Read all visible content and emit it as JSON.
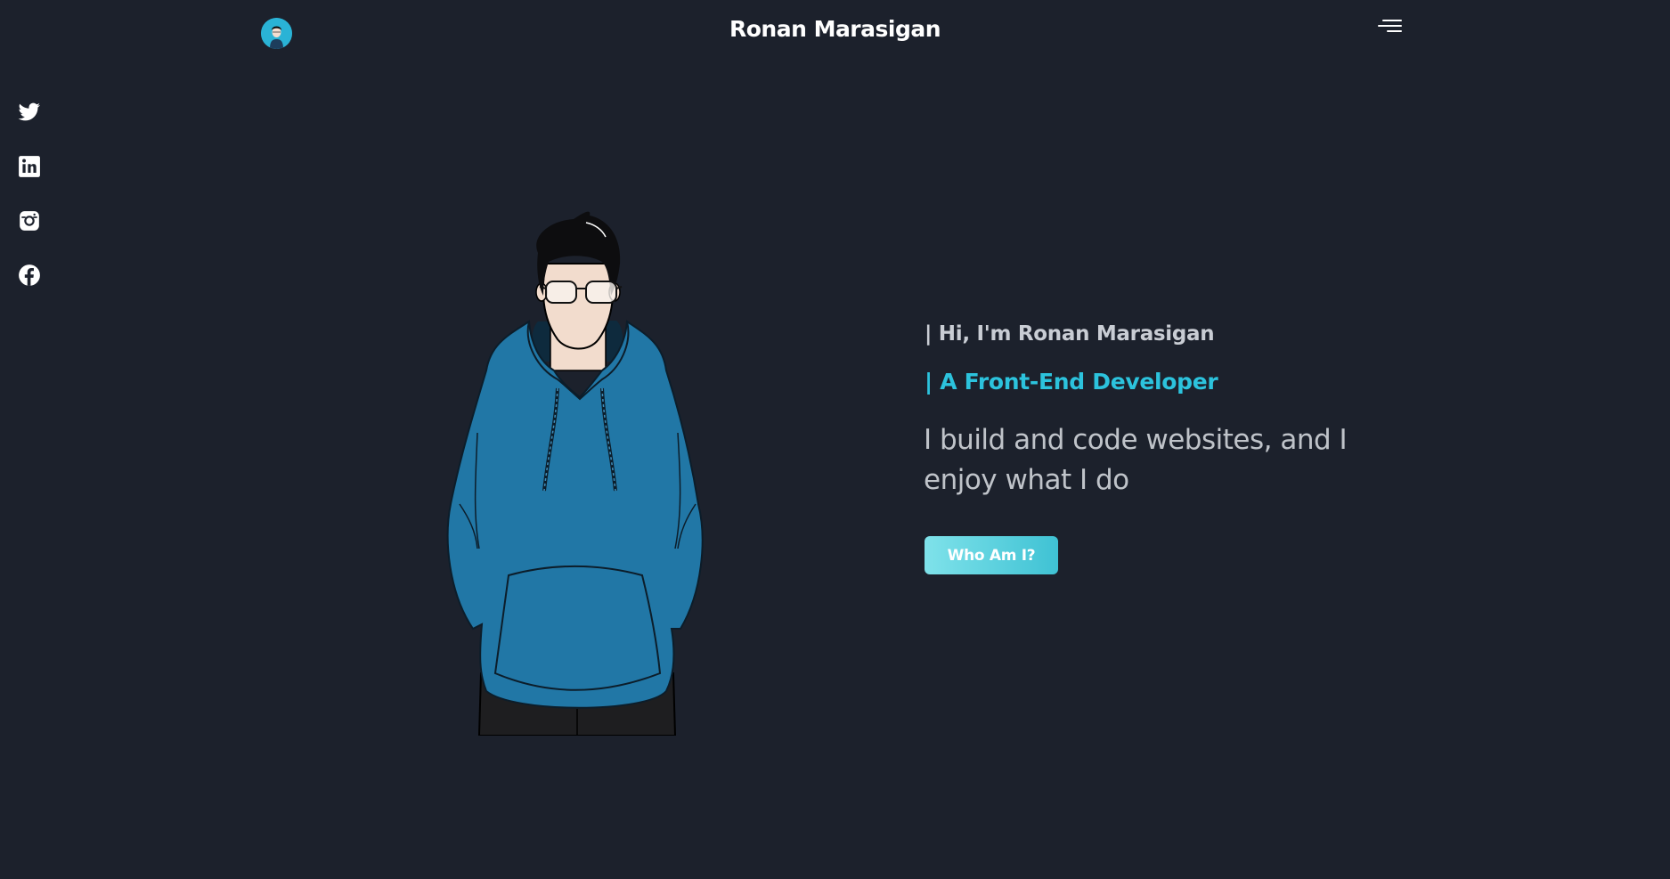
{
  "header": {
    "title": "Ronan Marasigan",
    "avatar_icon": "avatar-icon",
    "menu_icon": "hamburger-menu-icon"
  },
  "social": [
    {
      "name": "twitter",
      "icon": "twitter-icon"
    },
    {
      "name": "linkedin",
      "icon": "linkedin-icon"
    },
    {
      "name": "instagram",
      "icon": "instagram-icon"
    },
    {
      "name": "facebook",
      "icon": "facebook-icon"
    }
  ],
  "hero": {
    "greeting": "| Hi, I'm Ronan Marasigan",
    "role": "| A Front-End Developer",
    "tagline": "I build and code websites, and I enjoy what I do",
    "cta_label": "Who Am I?"
  },
  "colors": {
    "background": "#1c212c",
    "accent": "#2cc3dd",
    "hoodie": "#2177a6",
    "button_start": "#7fe2ea",
    "button_end": "#3fc2d4"
  }
}
